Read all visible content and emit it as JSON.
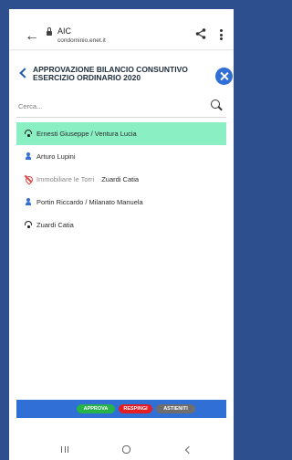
{
  "browser": {
    "site_title": "AIC",
    "site_url": "condominio.enet.it"
  },
  "header": {
    "title": "APPROVAZIONE BILANCIO CONSUNTIVO ESERCIZIO ORDINARIO 2020"
  },
  "search": {
    "placeholder": "Cerca..."
  },
  "rows": [
    {
      "name": "Ernesti Giuseppe / Ventura Lucia",
      "icon": "wifi-icon",
      "selected": true
    },
    {
      "name": "Arturo Lupini",
      "icon": "person-icon",
      "selected": false
    },
    {
      "name": "Immobiliare le Torri",
      "delegate": "Zuardi Catia",
      "icon": "blocked-icon",
      "selected": false
    },
    {
      "name": "Portin Riccardo / Milanato Manuela",
      "icon": "person-icon",
      "selected": false
    },
    {
      "name": "Zuardi Catia",
      "icon": "wifi-icon",
      "selected": false
    }
  ],
  "actions": {
    "approve": "APPROVA",
    "reject": "RESPINGI",
    "abstain": "ASTIENITI"
  },
  "colors": {
    "frame": "#2d4f8e",
    "accent": "#2f6fd6",
    "selected_row": "#8af0c4",
    "approve": "#25b34a",
    "reject": "#e31e24",
    "abstain": "#6e6e6e"
  }
}
